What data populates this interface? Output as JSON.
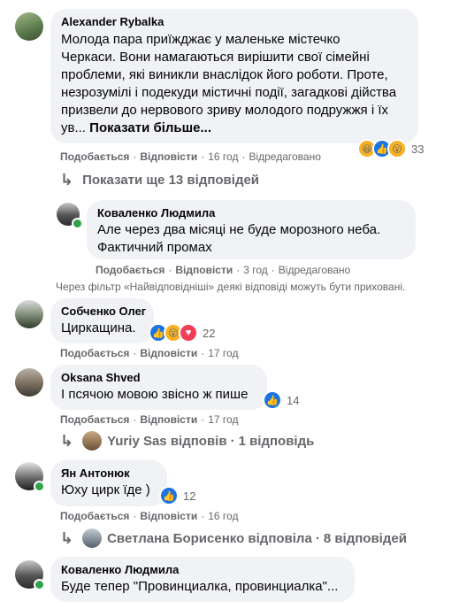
{
  "colors": {
    "bubble": "#f0f2f5",
    "link": "#385898",
    "muted": "#65676b",
    "like": "#1b74e4",
    "online": "#31a24c"
  },
  "actions": {
    "like": "Подобається",
    "reply": "Відповісти",
    "edited": "Відредаговано"
  },
  "comments": [
    {
      "author": "Alexander Rybalka",
      "text_lines": [
        "Молода пара приїжджає у маленьке містечко",
        "Черкаси. Вони намагаються вирішити свої сімейні",
        "проблеми, які виникли внаслідок його роботи. Проте,",
        "незрозумілі і подекуди містичні події, загадкові дійства",
        "призвели до нервового зриву молодого подружжя і їх"
      ],
      "text_tail": "ув...",
      "see_more": "Показати більше...",
      "time": "16 год",
      "reactions_icons": [
        "haha-icon",
        "like-icon",
        "wow-icon"
      ],
      "reaction_count": "33",
      "view_more": "Показати ще 13 відповідей"
    },
    {
      "author": "Коваленко Людмила",
      "text_lines": [
        "Але через два місяці не буде морозного неба.",
        "Фактичний промах"
      ],
      "time": "3 год"
    },
    {
      "author": "Собченко Олег",
      "text": "Циркащина.",
      "time": "17 год",
      "reactions_icons": [
        "like-icon",
        "wow-icon",
        "love-icon"
      ],
      "reaction_count": "22"
    },
    {
      "author": "Oksana Shved",
      "text": "І псячою мовою звісно ж пише",
      "time": "17 год",
      "reactions_icons": [
        "like-icon"
      ],
      "reaction_count": "14",
      "reply_summary": {
        "name": "Yuriy Sas",
        "verb": "відповів",
        "count": "1 відповідь"
      }
    },
    {
      "author": "Ян Антонюк",
      "text": "Юху цирк їде )",
      "time": "16 год",
      "reactions_icons": [
        "like-icon"
      ],
      "reaction_count": "12",
      "reply_summary": {
        "name": "Светлана Борисенко",
        "verb": "відповіла",
        "count": "8 відповідей"
      }
    },
    {
      "author": "Коваленко Людмила",
      "text": "Буде тепер \"Провинциалка, провинциалка\"..."
    }
  ],
  "filter_note": "Через фільтр «Найвідповідніші» деякі відповіді можуть бути приховані."
}
